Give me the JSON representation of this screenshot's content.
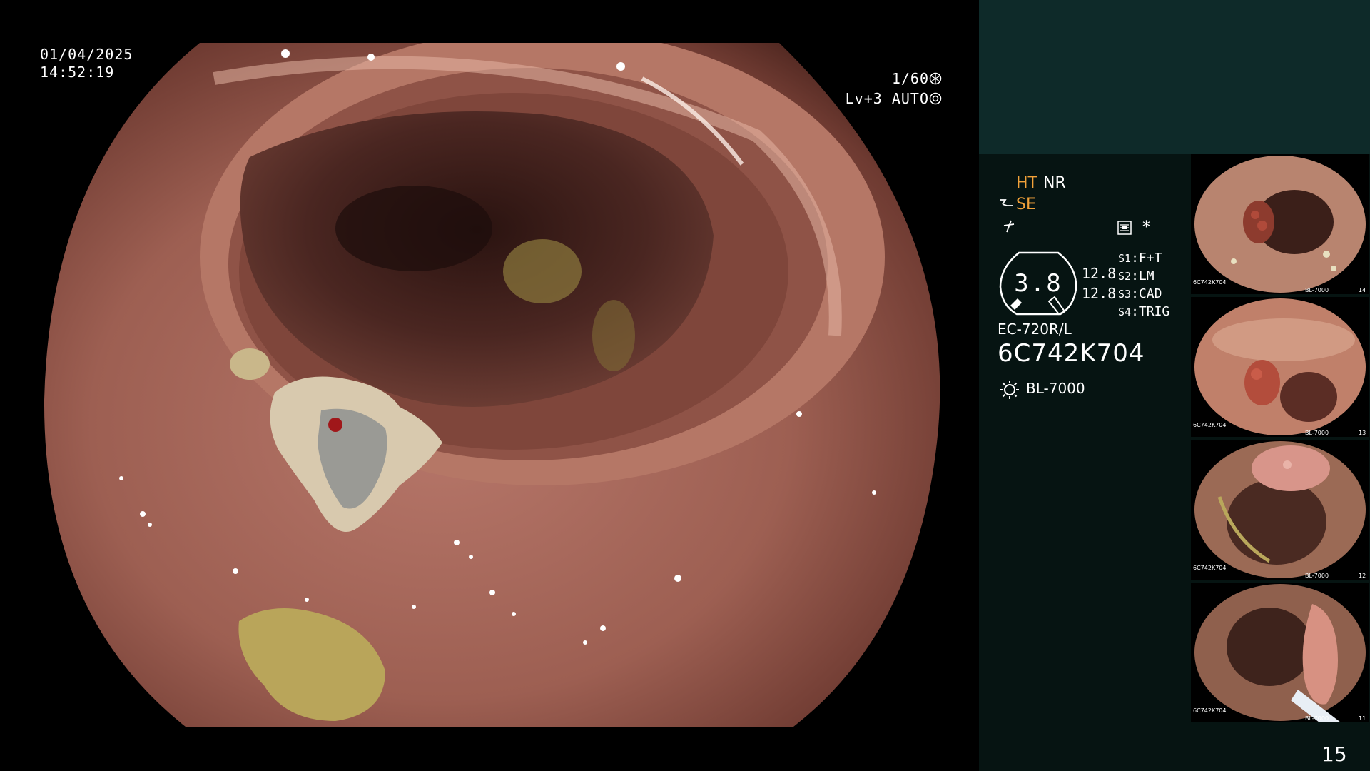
{
  "osd": {
    "date": "01/04/2025",
    "time": "14:52:19",
    "shutter": "1/60",
    "shutter_icon": "shutter-icon",
    "level": "Lv+3",
    "iris_mode": "AUTO",
    "iris_icon": "iris-icon"
  },
  "panel": {
    "mode_ht": "HT",
    "mode_nr": "NR",
    "mode_se": "SE",
    "zoom_value": "3.8",
    "zoom_a": "12.8",
    "zoom_b": "12.8",
    "switches": [
      {
        "key": "S1",
        "value": "F+T"
      },
      {
        "key": "S2",
        "value": "LM"
      },
      {
        "key": "S3",
        "value": "CAD"
      },
      {
        "key": "S4",
        "value": "TRIG"
      }
    ],
    "scope_model": "EC-720R/L",
    "scope_serial": "6C742K704",
    "light_source": "BL-7000",
    "star": "*",
    "page_number": "15",
    "colors": {
      "panel_top": "#0e2a29",
      "panel_bottom": "#061412",
      "accent": "#f2a23a"
    }
  },
  "thumbnails": [
    {
      "caption_model": "6C742K704",
      "caption_light": "BL-7000",
      "index": "14"
    },
    {
      "caption_model": "6C742K704",
      "caption_light": "BL-7000",
      "index": "13"
    },
    {
      "caption_model": "6C742K704",
      "caption_light": "BL-7000",
      "index": "12"
    },
    {
      "caption_model": "6C742K704",
      "caption_light": "BL-7000",
      "index": "11"
    }
  ]
}
